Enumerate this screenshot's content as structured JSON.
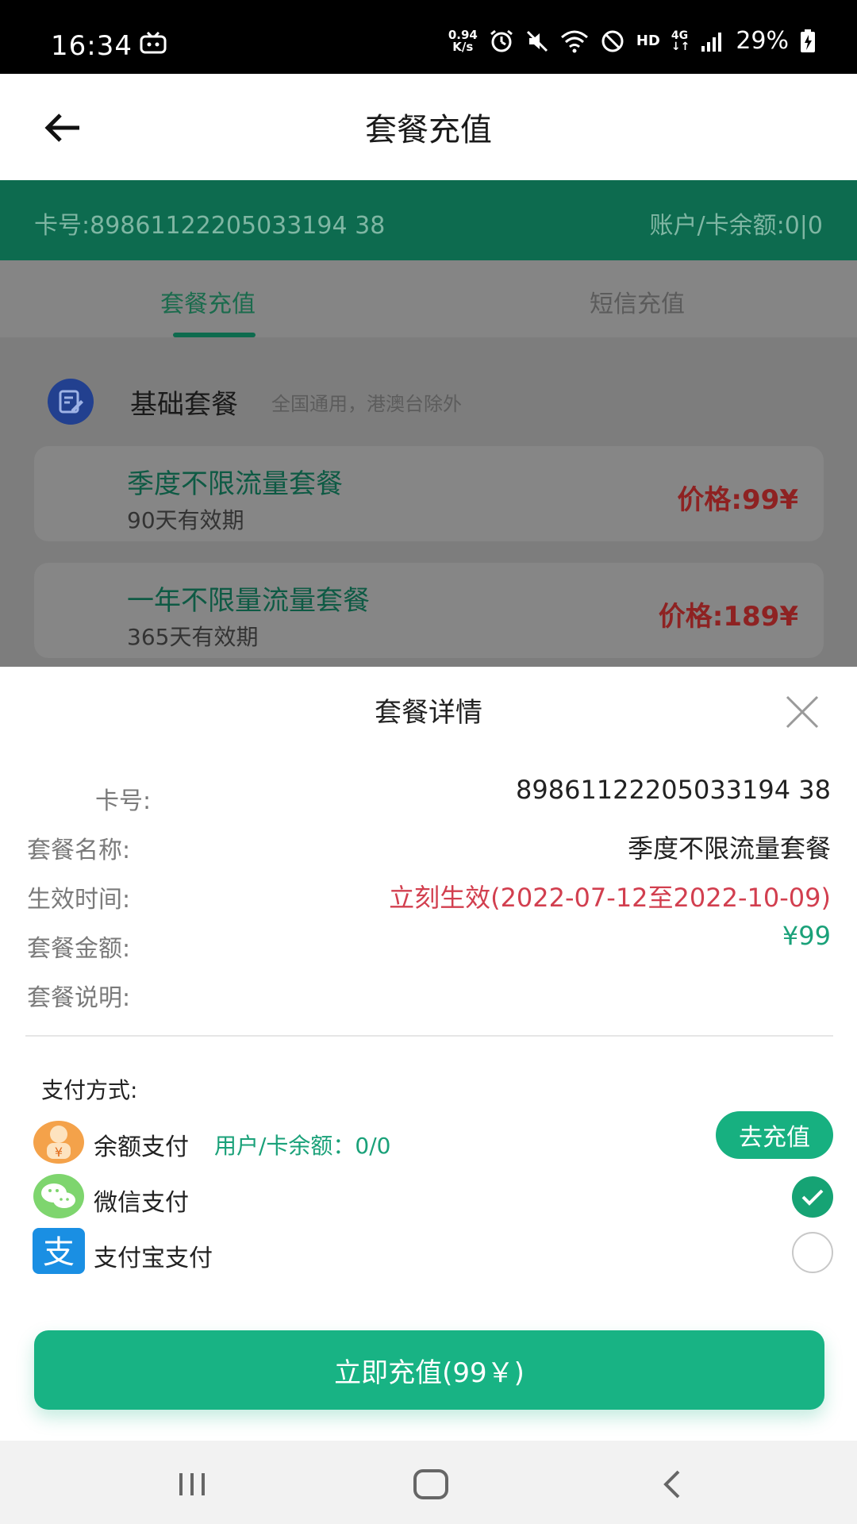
{
  "status_bar": {
    "time": "16:34",
    "net_speed_value": "0.94",
    "net_speed_unit": "K/s",
    "hd": "HD",
    "network_type": "4G",
    "battery": "29%"
  },
  "app_bar": {
    "title": "套餐充值",
    "back_icon": "arrow-left-icon"
  },
  "card_bar": {
    "card_number": "卡号:89861122205033194 38",
    "balance": "账户/卡余额:0|0"
  },
  "tabs": [
    {
      "label": "套餐充值",
      "active": true
    },
    {
      "label": "短信充值",
      "active": false
    }
  ],
  "section": {
    "title": "基础套餐",
    "subtitle": "全国通用，港澳台除外",
    "icon": "edit-document-icon"
  },
  "packages": [
    {
      "name": "季度不限流量套餐",
      "validity": "90天有效期",
      "price": "价格:99¥"
    },
    {
      "name": "一年不限量流量套餐",
      "validity": "365天有效期",
      "price": "价格:189¥"
    }
  ],
  "sheet": {
    "title": "套餐详情",
    "close_icon": "close-icon",
    "rows": [
      {
        "label": "卡号:",
        "value": "89861122205033194 38"
      },
      {
        "label": "套餐名称:",
        "value": "季度不限流量套餐"
      },
      {
        "label": "生效时间:",
        "value": "立刻生效(2022-07-12至2022-10-09)"
      },
      {
        "label": "套餐金额:",
        "value": "¥99"
      },
      {
        "label": "套餐说明:",
        "value": ""
      }
    ],
    "payment_label": "支付方式:",
    "payments": [
      {
        "name": "余额支付",
        "balance": "用户/卡余额：0/0",
        "action": "去充值",
        "icon": "piggy-bank-icon"
      },
      {
        "name": "微信支付",
        "selected": true,
        "icon": "wechat-icon"
      },
      {
        "name": "支付宝支付",
        "selected": false,
        "icon": "alipay-icon"
      }
    ],
    "submit_label": "立即充值(99￥)"
  },
  "colors": {
    "brand_green": "#18b384",
    "dark_green": "#0d6b4f",
    "price_red": "#d23f4f",
    "amount_green": "#1aa179"
  }
}
